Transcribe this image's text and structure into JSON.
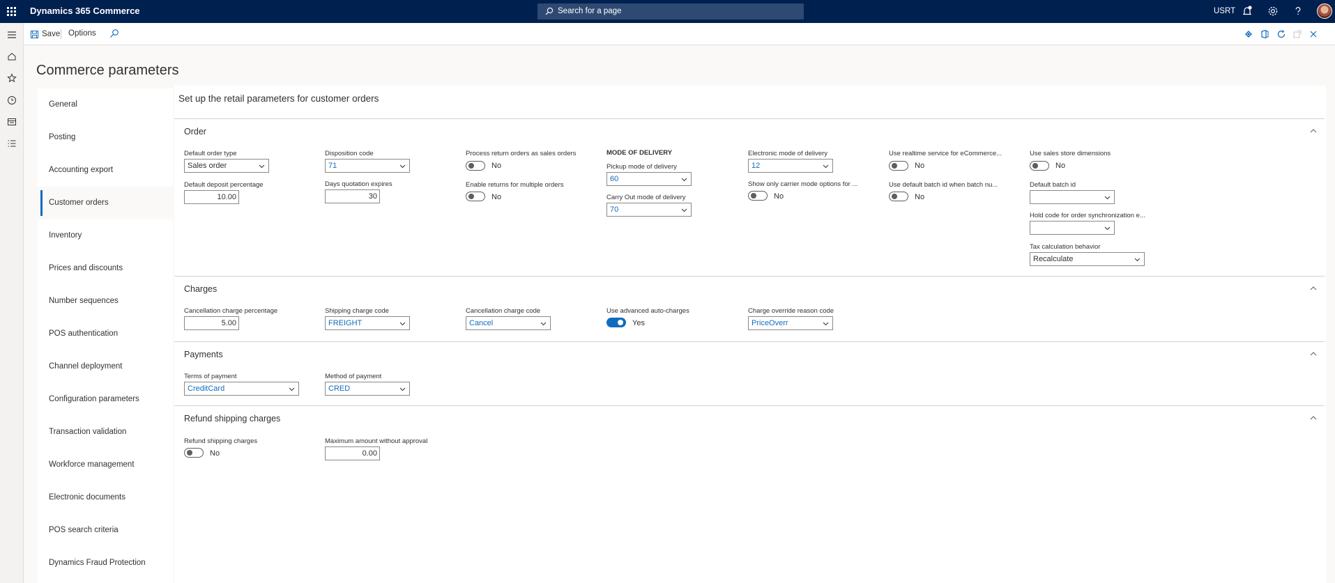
{
  "app": {
    "title": "Dynamics 365 Commerce",
    "user": "USRT"
  },
  "search": {
    "placeholder": "Search for a page"
  },
  "toolbar": {
    "save_label": "Save",
    "options_label": "Options"
  },
  "page": {
    "title": "Commerce parameters",
    "subtitle": "Set up the retail parameters for customer orders"
  },
  "tabs": [
    {
      "label": "General"
    },
    {
      "label": "Posting"
    },
    {
      "label": "Accounting export"
    },
    {
      "label": "Customer orders"
    },
    {
      "label": "Inventory"
    },
    {
      "label": "Prices and discounts"
    },
    {
      "label": "Number sequences"
    },
    {
      "label": "POS authentication"
    },
    {
      "label": "Channel deployment"
    },
    {
      "label": "Configuration parameters"
    },
    {
      "label": "Transaction validation"
    },
    {
      "label": "Workforce management"
    },
    {
      "label": "Electronic documents"
    },
    {
      "label": "POS search criteria"
    },
    {
      "label": "Dynamics Fraud Protection"
    }
  ],
  "order": {
    "title": "Order",
    "default_order_type": {
      "label": "Default order type",
      "value": "Sales order"
    },
    "default_deposit_pct": {
      "label": "Default deposit percentage",
      "value": "10.00"
    },
    "disposition_code": {
      "label": "Disposition code",
      "value": "71"
    },
    "days_quotation_expires": {
      "label": "Days quotation expires",
      "value": "30"
    },
    "process_return_orders": {
      "label": "Process return orders as sales orders",
      "value": "No"
    },
    "enable_returns_multiple": {
      "label": "Enable returns for multiple orders",
      "value": "No"
    },
    "mode_of_delivery_header": "MODE OF DELIVERY",
    "pickup_mode": {
      "label": "Pickup mode of delivery",
      "value": "60"
    },
    "carry_out_mode": {
      "label": "Carry Out mode of delivery",
      "value": "70"
    },
    "electronic_mode": {
      "label": "Electronic mode of delivery",
      "value": "12"
    },
    "show_only_carrier": {
      "label": "Show only carrier mode options for ...",
      "value": "No"
    },
    "use_realtime": {
      "label": "Use realtime service for eCommerce...",
      "value": "No"
    },
    "use_default_batch": {
      "label": "Use default batch id when batch nu...",
      "value": "No"
    },
    "use_sales_store_dims": {
      "label": "Use sales store dimensions",
      "value": "No"
    },
    "default_batch_id": {
      "label": "Default batch id",
      "value": ""
    },
    "hold_code": {
      "label": "Hold code for order synchronization e...",
      "value": ""
    },
    "tax_calc": {
      "label": "Tax calculation behavior",
      "value": "Recalculate"
    }
  },
  "charges": {
    "title": "Charges",
    "cancellation_pct": {
      "label": "Cancellation charge percentage",
      "value": "5.00"
    },
    "shipping_code": {
      "label": "Shipping charge code",
      "value": "FREIGHT"
    },
    "cancellation_code": {
      "label": "Cancellation charge code",
      "value": "Cancel"
    },
    "advanced_auto": {
      "label": "Use advanced auto-charges",
      "value": "Yes"
    },
    "override_reason": {
      "label": "Charge override reason code",
      "value": "PriceOverr"
    }
  },
  "payments": {
    "title": "Payments",
    "terms": {
      "label": "Terms of payment",
      "value": "CreditCard"
    },
    "method": {
      "label": "Method of payment",
      "value": "CRED"
    }
  },
  "refund": {
    "title": "Refund shipping charges",
    "refund_toggle": {
      "label": "Refund shipping charges",
      "value": "No"
    },
    "max_amount": {
      "label": "Maximum amount without approval",
      "value": "0.00"
    }
  },
  "colors": {
    "header_bg": "#002050",
    "accent": "#0f6cbd"
  }
}
